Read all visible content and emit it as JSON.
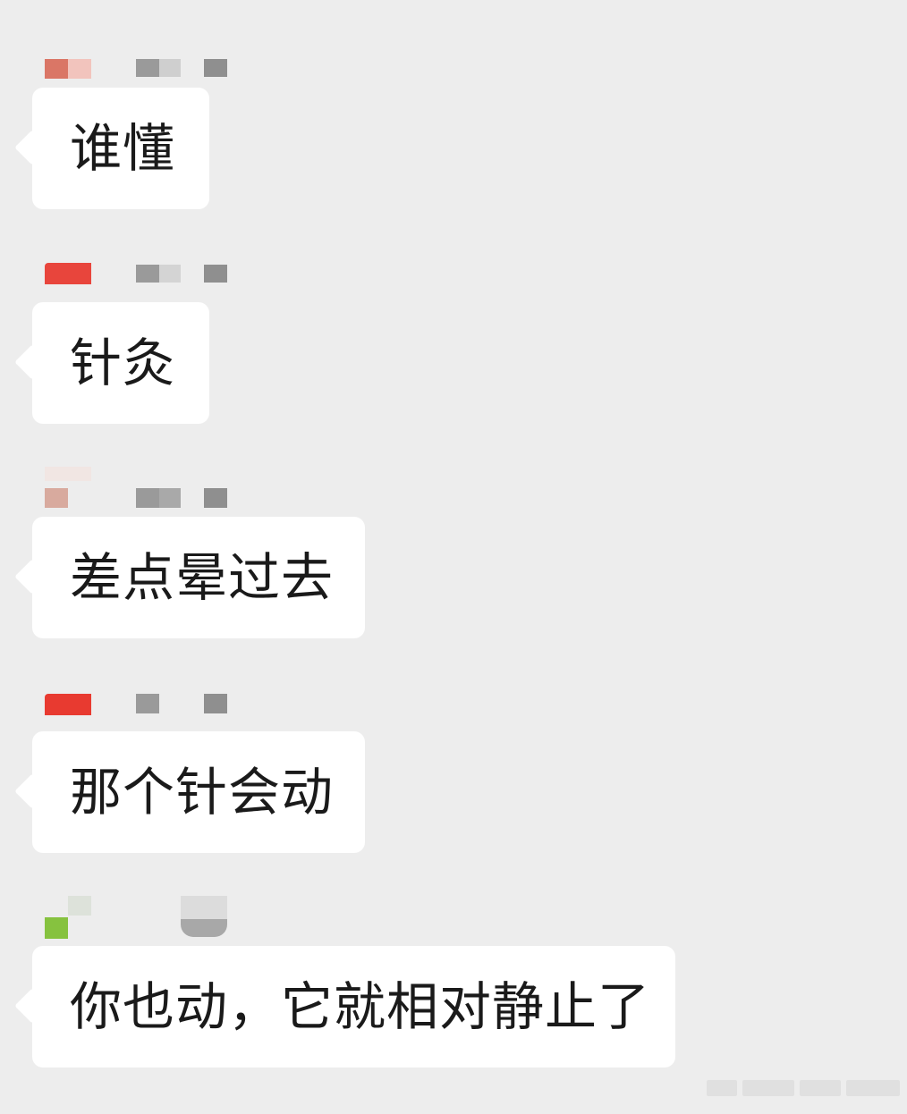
{
  "messages": [
    {
      "text": "谁懂",
      "avatar_color": "#d9705f"
    },
    {
      "text": "针灸",
      "avatar_color": "#e8453c"
    },
    {
      "text": "差点晕过去",
      "avatar_color": "#d8aa9e"
    },
    {
      "text": "那个针会动",
      "avatar_color": "#e83a30"
    },
    {
      "text": "你也动，它就相对静止了",
      "avatar_color": "#86c23f"
    }
  ],
  "colors": {
    "background": "#ededed",
    "bubble": "#ffffff",
    "text": "#1a1a1a",
    "name_blur": "#9a9a9a"
  }
}
